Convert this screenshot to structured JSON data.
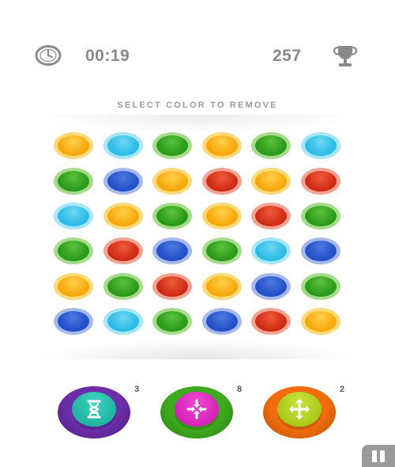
{
  "hud": {
    "timer": "00:19",
    "score": "257"
  },
  "instruction": "SELECT COLOR TO REMOVE",
  "colors": {
    "orange": {
      "core": "#f6a80b",
      "ring": "#fcd97a",
      "hi": "#ffd04a"
    },
    "cyan": {
      "core": "#2bbbe6",
      "ring": "#a7e6f7",
      "hi": "#6fd6f3"
    },
    "green": {
      "core": "#2a9a1a",
      "ring": "#a7db8c",
      "hi": "#5cc23c"
    },
    "blue": {
      "core": "#2250c8",
      "ring": "#a6b9ea",
      "hi": "#4d79e0"
    },
    "red": {
      "core": "#cf2b14",
      "ring": "#f1a394",
      "hi": "#ef5a3c"
    }
  },
  "grid": [
    [
      "orange",
      "cyan",
      "green",
      "orange",
      "green",
      "cyan"
    ],
    [
      "green",
      "blue",
      "orange",
      "red",
      "orange",
      "red"
    ],
    [
      "cyan",
      "orange",
      "green",
      "orange",
      "red",
      "green"
    ],
    [
      "green",
      "red",
      "blue",
      "green",
      "cyan",
      "blue"
    ],
    [
      "orange",
      "green",
      "red",
      "orange",
      "blue",
      "green"
    ],
    [
      "blue",
      "cyan",
      "green",
      "blue",
      "red",
      "orange"
    ]
  ],
  "powerups": [
    {
      "name": "hourglass",
      "count": "3",
      "base": "#6b2ea8",
      "base_edge": "#4d1d7e",
      "cap": "#1fb5a1",
      "cap_hi": "#3fd4be"
    },
    {
      "name": "shrink",
      "count": "8",
      "base": "#3daa1d",
      "base_edge": "#2a7d12",
      "cap": "#d424b8",
      "cap_hi": "#ef48d4"
    },
    {
      "name": "expand",
      "count": "2",
      "base": "#f06c0c",
      "base_edge": "#b94f05",
      "cap": "#a9c91a",
      "cap_hi": "#c8e33b"
    }
  ]
}
